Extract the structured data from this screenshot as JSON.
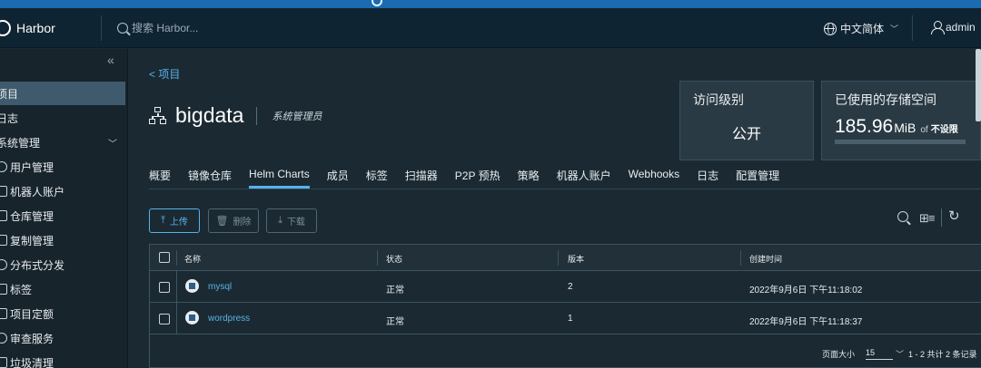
{
  "header": {
    "brand": "Harbor",
    "search_placeholder": "搜索 Harbor...",
    "language": "中文简体",
    "user": "admin"
  },
  "sidebar": {
    "items": [
      {
        "label": "项目",
        "active": true,
        "icon": "folder-icon"
      },
      {
        "label": "日志",
        "active": false,
        "icon": "log-icon"
      },
      {
        "label": "系统管理",
        "active": false,
        "icon": "admin-icon",
        "expanded": true
      },
      {
        "label": "用户管理",
        "active": false,
        "icon": "users-icon"
      },
      {
        "label": "机器人账户",
        "active": false,
        "icon": "robot-icon"
      },
      {
        "label": "仓库管理",
        "active": false,
        "icon": "registry-icon"
      },
      {
        "label": "复制管理",
        "active": false,
        "icon": "replication-icon"
      },
      {
        "label": "分布式分发",
        "active": false,
        "icon": "distribution-icon"
      },
      {
        "label": "标签",
        "active": false,
        "icon": "tag-icon"
      },
      {
        "label": "项目定额",
        "active": false,
        "icon": "quota-icon"
      },
      {
        "label": "审查服务",
        "active": false,
        "icon": "scanner-icon"
      },
      {
        "label": "垃圾清理",
        "active": false,
        "icon": "trash-icon"
      }
    ]
  },
  "breadcrumb": {
    "back": "< 项目"
  },
  "project": {
    "name": "bigdata",
    "role": "系统管理员"
  },
  "cards": {
    "access": {
      "title": "访问级别",
      "value": "公开"
    },
    "storage": {
      "title": "已使用的存储空间",
      "number": "185.96",
      "unit": "MiB",
      "of": "of",
      "limit": "不设限",
      "progress": 0.0
    }
  },
  "tabs": [
    {
      "label": "概要",
      "active": false
    },
    {
      "label": "镜像仓库",
      "active": false
    },
    {
      "label": "Helm Charts",
      "active": true
    },
    {
      "label": "成员",
      "active": false
    },
    {
      "label": "标签",
      "active": false
    },
    {
      "label": "扫描器",
      "active": false
    },
    {
      "label": "P2P 预热",
      "active": false
    },
    {
      "label": "策略",
      "active": false
    },
    {
      "label": "机器人账户",
      "active": false
    },
    {
      "label": "Webhooks",
      "active": false
    },
    {
      "label": "日志",
      "active": false
    },
    {
      "label": "配置管理",
      "active": false
    }
  ],
  "actions": {
    "upload": "上传",
    "delete": "删除",
    "download": "下载"
  },
  "table": {
    "columns": [
      "名称",
      "状态",
      "版本",
      "创建时间"
    ],
    "rows": [
      {
        "name": "mysql",
        "status": "正常",
        "version": "2",
        "created": "2022年9月6日 下午11:18:02"
      },
      {
        "name": "wordpress",
        "status": "正常",
        "version": "1",
        "created": "2022年9月6日 下午11:18:37"
      }
    ],
    "footer": {
      "page_size_label": "页面大小",
      "page_size": "15",
      "summary": "1 - 2 共计 2 条记录"
    }
  },
  "colors": {
    "accent": "#57b2ea",
    "header_bg": "#0f2433",
    "body_bg": "#1b2a32",
    "active_nav": "#3e5a6c"
  }
}
